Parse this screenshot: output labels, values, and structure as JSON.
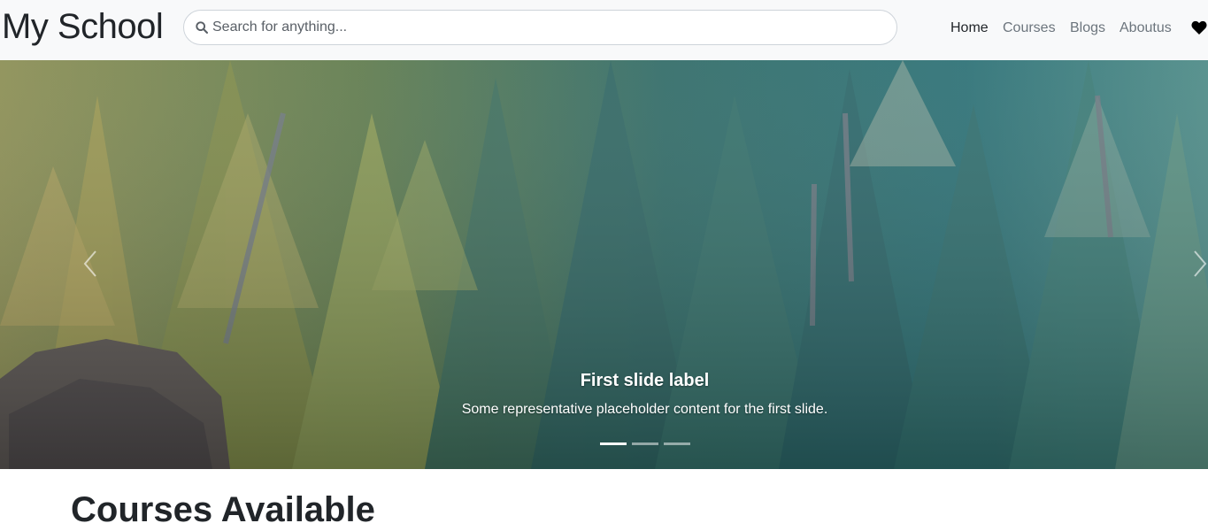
{
  "brand": "My School",
  "search": {
    "placeholder": "Search for anything..."
  },
  "nav": {
    "items": [
      {
        "label": "Home",
        "active": true
      },
      {
        "label": "Courses",
        "active": false
      },
      {
        "label": "Blogs",
        "active": false
      },
      {
        "label": "Aboutus",
        "active": false
      }
    ],
    "wishlist_icon": "heart-icon"
  },
  "carousel": {
    "caption_title": "First slide label",
    "caption_text": "Some representative placeholder content for the first slide.",
    "slide_count": 3,
    "active_index": 0,
    "prev_icon": "chevron-left-icon",
    "next_icon": "chevron-right-icon"
  },
  "section": {
    "title": "Courses Available"
  },
  "colors": {
    "navbar_bg": "#f8f9fa",
    "text": "#212529",
    "nav_muted": "#6c757d"
  }
}
